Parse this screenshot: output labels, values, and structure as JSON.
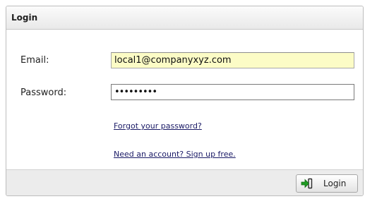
{
  "panel": {
    "title": "Login"
  },
  "form": {
    "email_label": "Email:",
    "email_value": "local1@companyxyz.com",
    "password_label": "Password:",
    "password_value": "•••••••••"
  },
  "links": {
    "forgot_password": "Forgot your password?",
    "sign_up": "Need an account? Sign up free."
  },
  "footer": {
    "login_button_label": "Login",
    "login_button_icon": "login-arrow-icon",
    "icon_color": "#1e9b22"
  }
}
